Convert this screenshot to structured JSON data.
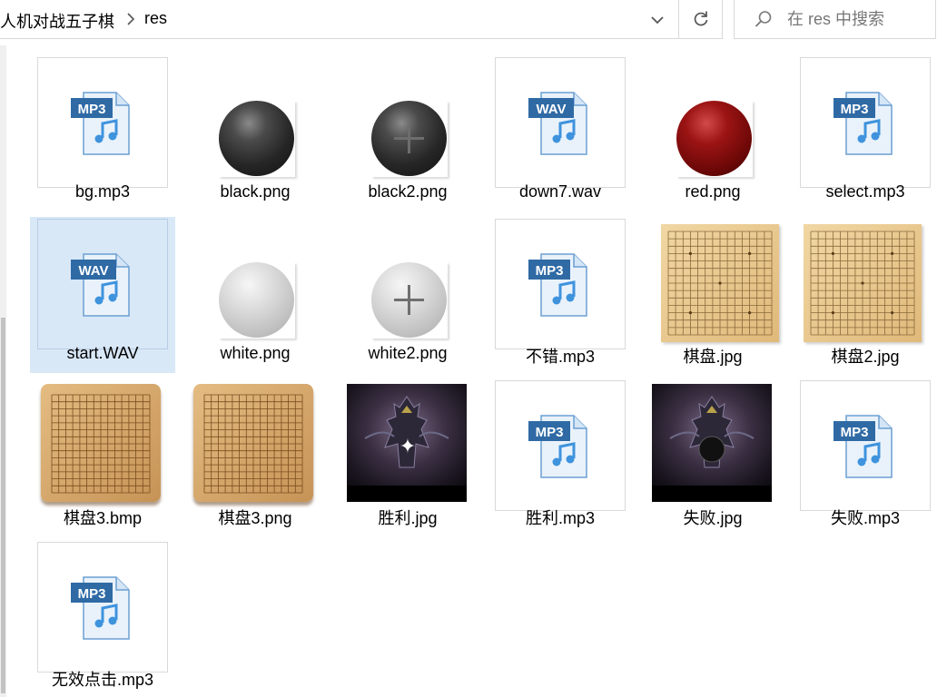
{
  "address_bar": {
    "breadcrumb": [
      "人机对战五子棋",
      "res"
    ]
  },
  "search": {
    "placeholder": "在 res 中搜索"
  },
  "files": [
    {
      "name": "bg.mp3",
      "icon": "mp3-file-icon",
      "badge": "MP3"
    },
    {
      "name": "black.png",
      "icon": "black-stone-thumbnail"
    },
    {
      "name": "black2.png",
      "icon": "black-stone-plus-thumbnail"
    },
    {
      "name": "down7.wav",
      "icon": "wav-file-icon",
      "badge": "WAV"
    },
    {
      "name": "red.png",
      "icon": "red-stone-thumbnail"
    },
    {
      "name": "select.mp3",
      "icon": "mp3-file-icon",
      "badge": "MP3"
    },
    {
      "name": "start.WAV",
      "icon": "wav-file-icon",
      "badge": "WAV",
      "selected": true
    },
    {
      "name": "white.png",
      "icon": "white-stone-thumbnail"
    },
    {
      "name": "white2.png",
      "icon": "white-stone-plus-thumbnail"
    },
    {
      "name": "不错.mp3",
      "icon": "mp3-file-icon",
      "badge": "MP3"
    },
    {
      "name": "棋盘.jpg",
      "icon": "go-board-thumbnail"
    },
    {
      "name": "棋盘2.jpg",
      "icon": "go-board-thumbnail"
    },
    {
      "name": "棋盘3.bmp",
      "icon": "wooden-board-thumbnail"
    },
    {
      "name": "棋盘3.png",
      "icon": "wooden-board-thumbnail"
    },
    {
      "name": "胜利.jpg",
      "icon": "victory-image-thumbnail"
    },
    {
      "name": "胜利.mp3",
      "icon": "mp3-file-icon",
      "badge": "MP3"
    },
    {
      "name": "失败.jpg",
      "icon": "defeat-image-thumbnail"
    },
    {
      "name": "失败.mp3",
      "icon": "mp3-file-icon",
      "badge": "MP3"
    },
    {
      "name": "无效点击.mp3",
      "icon": "mp3-file-icon",
      "badge": "MP3"
    }
  ]
}
